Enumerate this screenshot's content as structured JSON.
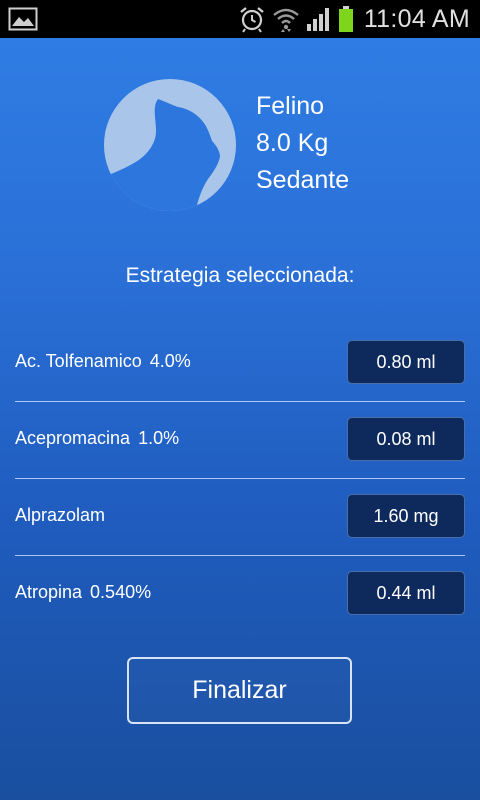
{
  "status_bar": {
    "time": "11:04 AM",
    "icons": [
      "gallery-icon",
      "alarm-icon",
      "wifi-icon",
      "signal-icon",
      "battery-icon"
    ]
  },
  "patient": {
    "species": "Felino",
    "weight": "8.0 Kg",
    "procedure": "Sedante",
    "avatar_icon": "cat-silhouette-icon"
  },
  "strategy_title": "Estrategia seleccionada:",
  "medications": [
    {
      "name": "Ac. Tolfenamico",
      "concentration": "4.0%",
      "dose": "0.80 ml"
    },
    {
      "name": "Acepromacina",
      "concentration": "1.0%",
      "dose": "0.08 ml"
    },
    {
      "name": "Alprazolam",
      "concentration": "",
      "dose": "1.60 mg"
    },
    {
      "name": "Atropina",
      "concentration": "0.540%",
      "dose": "0.44 ml"
    }
  ],
  "finish_button": "Finalizar",
  "colors": {
    "background_top": "#2f7fe6",
    "background_bottom": "#1a4f9f",
    "dose_box": "#0e2a5c",
    "avatar_circle": "#a9c6ea",
    "battery": "#7fd41c"
  }
}
